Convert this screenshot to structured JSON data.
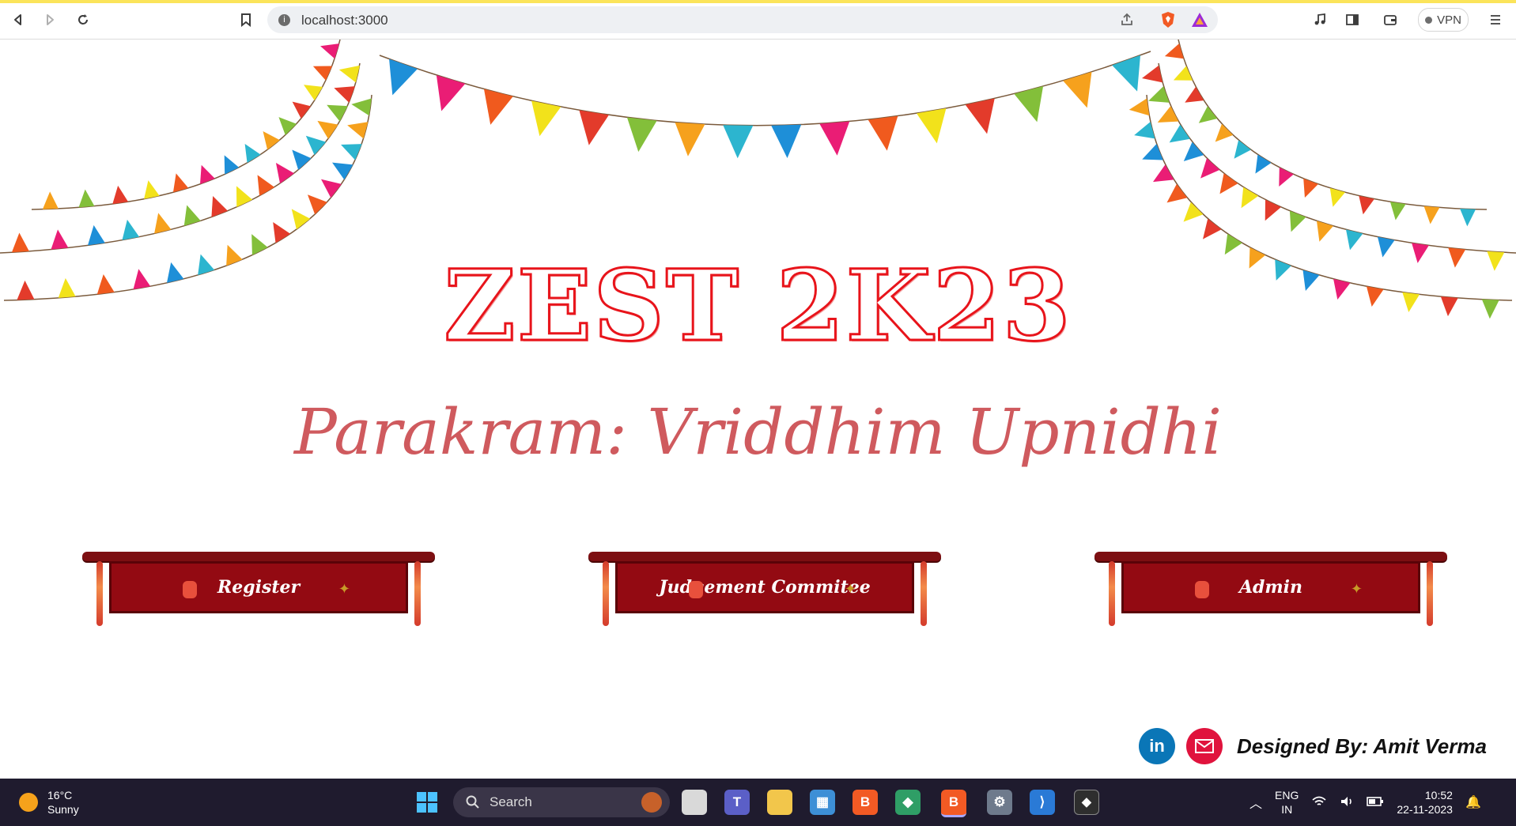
{
  "browser": {
    "url": "localhost:3000",
    "vpn_label": "VPN",
    "nav": {
      "back_icon": "back-icon",
      "forward_icon": "forward-icon",
      "reload_icon": "reload-icon",
      "bookmark_icon": "bookmark-icon"
    }
  },
  "page": {
    "title": "ZEST 2K23",
    "subtitle": "Parakram: Vriddhim Upnidhi",
    "buttons": [
      {
        "label": "Register"
      },
      {
        "label": "Judgement Commitee"
      },
      {
        "label": "Admin"
      }
    ],
    "footer": {
      "credit": "Designed By: Amit Verma",
      "linkedin_label": "in",
      "linkedin_color": "#0a76b7",
      "email_color": "#e0133d"
    },
    "colors": {
      "title": "#e8141b",
      "subtitle": "#cf5a5e",
      "banner": "#930a12"
    }
  },
  "taskbar": {
    "weather_temp": "16°C",
    "weather_desc": "Sunny",
    "search_label": "Search",
    "language": "ENG",
    "region": "IN",
    "time": "10:52",
    "date": "22-11-2023"
  }
}
